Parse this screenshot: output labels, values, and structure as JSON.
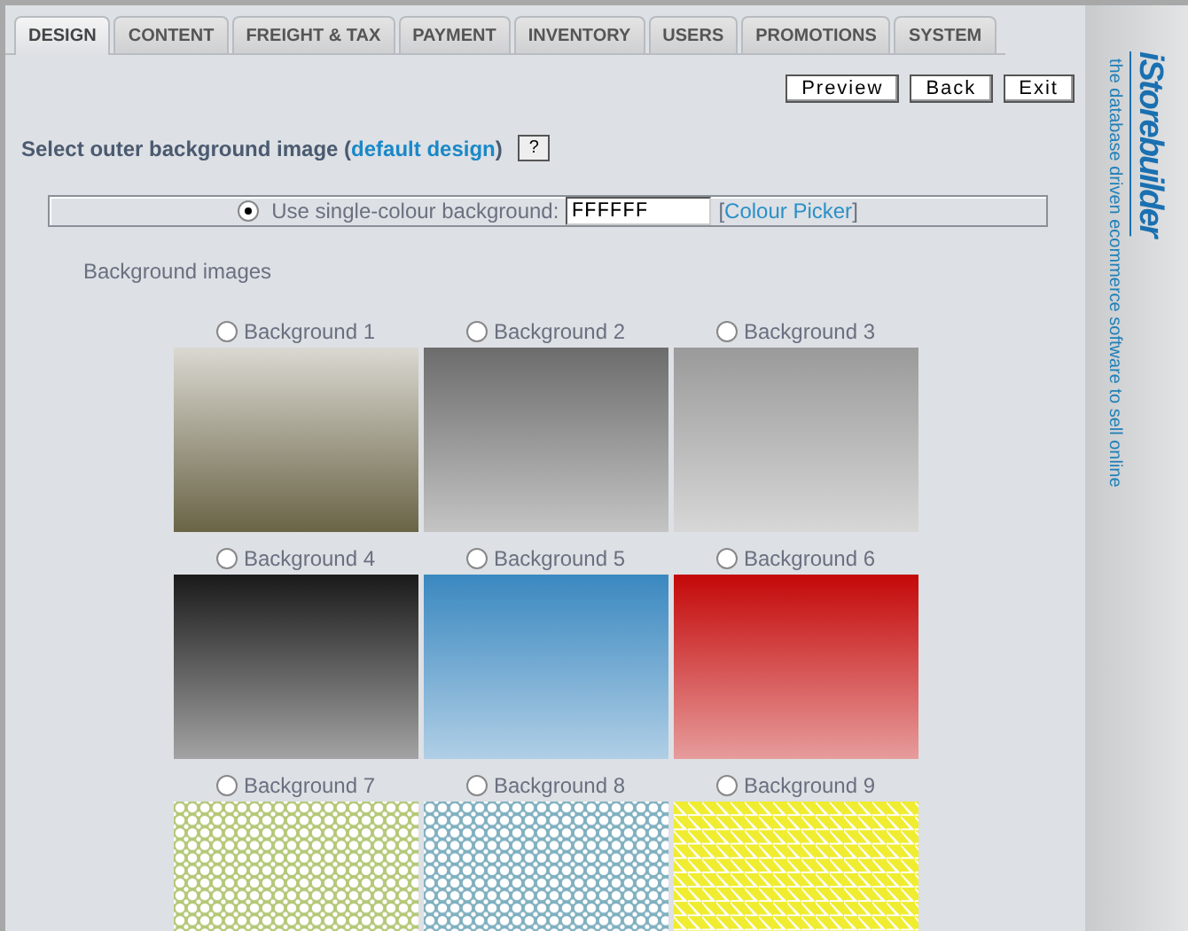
{
  "tabs": [
    {
      "label": "DESIGN",
      "selected": true
    },
    {
      "label": "CONTENT",
      "selected": false
    },
    {
      "label": "FREIGHT & TAX",
      "selected": false
    },
    {
      "label": "PAYMENT",
      "selected": false
    },
    {
      "label": "INVENTORY",
      "selected": false
    },
    {
      "label": "USERS",
      "selected": false
    },
    {
      "label": "PROMOTIONS",
      "selected": false
    },
    {
      "label": "SYSTEM",
      "selected": false
    }
  ],
  "buttons": [
    "Preview",
    "Back",
    "Exit"
  ],
  "heading": {
    "text": "Select outer background image",
    "link_open": "(",
    "link": "default design",
    "link_close": ")",
    "help": "?"
  },
  "single_colour": {
    "selected": true,
    "label": "Use single-colour background:",
    "value": "FFFFFF",
    "picker_open": "[",
    "picker": "Colour Picker",
    "picker_close": "]"
  },
  "section_label": "Background images",
  "backgrounds": [
    {
      "label": "Background 1",
      "selected": false,
      "kind": "gradient_up",
      "color": "#6a6446"
    },
    {
      "label": "Background 2",
      "selected": false,
      "kind": "gradient",
      "color": "#6c6c6c"
    },
    {
      "label": "Background 3",
      "selected": false,
      "kind": "gradient",
      "color": "#9a9a9a"
    },
    {
      "label": "Background 4",
      "selected": false,
      "kind": "gradient",
      "color": "#1a1a1a"
    },
    {
      "label": "Background 5",
      "selected": false,
      "kind": "gradient",
      "color": "#3a88c0"
    },
    {
      "label": "Background 6",
      "selected": false,
      "kind": "gradient",
      "color": "#c40808"
    },
    {
      "label": "Background 7",
      "selected": false,
      "kind": "pattern",
      "color": "#b4c878"
    },
    {
      "label": "Background 8",
      "selected": false,
      "kind": "pattern",
      "color": "#80b0c0"
    },
    {
      "label": "Background 9",
      "selected": false,
      "kind": "triangles",
      "color": "#f0ec30"
    }
  ],
  "logo": {
    "name": "iStorebuilder",
    "tagline": "the database driven ecommerce software to sell online"
  }
}
